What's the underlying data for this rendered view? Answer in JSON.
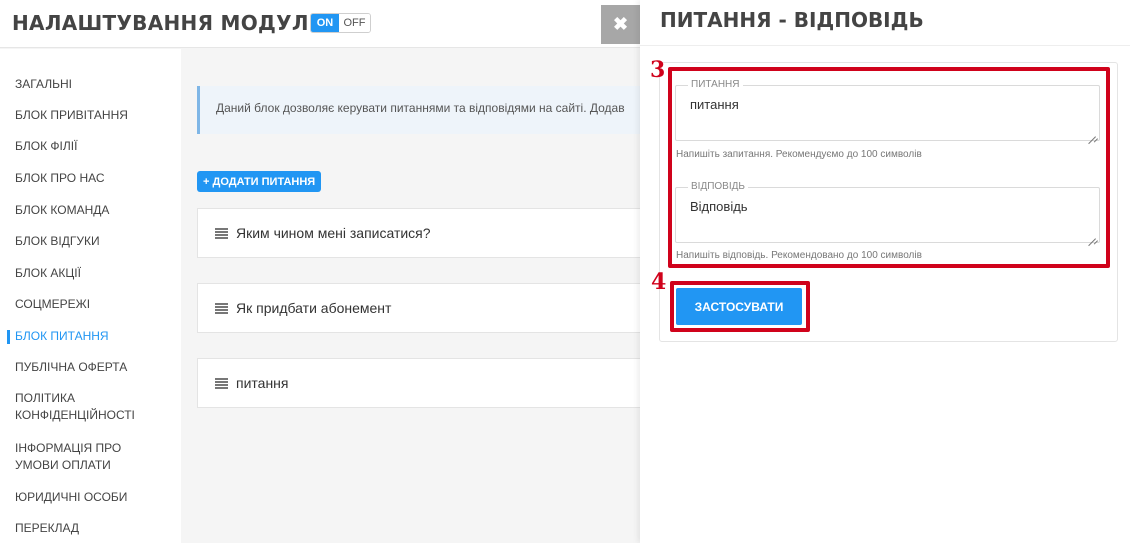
{
  "header": {
    "title": "НАЛАШТУВАННЯ МОДУЛЯ",
    "toggle_on": "ON",
    "toggle_off": "OFF",
    "close_glyph": "✖"
  },
  "sidebar": {
    "active_index": 8,
    "items": [
      {
        "label": "ЗАГАЛЬНІ"
      },
      {
        "label": "БЛОК ПРИВІТАННЯ"
      },
      {
        "label": "БЛОК ФІЛІЇ"
      },
      {
        "label": "БЛОК ПРО НАС"
      },
      {
        "label": "БЛОК КОМАНДА"
      },
      {
        "label": "БЛОК ВІДГУКИ"
      },
      {
        "label": "БЛОК АКЦІЇ"
      },
      {
        "label": "СОЦМЕРЕЖІ"
      },
      {
        "label": "БЛОК ПИТАННЯ"
      },
      {
        "label": "ПУБЛІЧНА ОФЕРТА"
      },
      {
        "label": "ПОЛІТИКА КОНФІДЕНЦІЙНОСТІ"
      },
      {
        "label": "ІНФОРМАЦІЯ ПРО УМОВИ ОПЛАТИ"
      },
      {
        "label": "ЮРИДИЧНІ ОСОБИ"
      },
      {
        "label": "ПЕРЕКЛАД"
      }
    ]
  },
  "main": {
    "info_text": "Даний блок дозволяє керувати питаннями та відповідями на сайті. Додав",
    "add_button": "+ ДОДАТИ ПИТАННЯ",
    "questions": [
      {
        "text": "Яким чином мені записатися?"
      },
      {
        "text": "Як придбати абонемент"
      },
      {
        "text": "питання"
      }
    ]
  },
  "panel": {
    "title": "ПИТАННЯ - ВІДПОВІДЬ",
    "question_field": {
      "label": "ПИТАННЯ",
      "value": "питання",
      "hint": "Напишіть запитання. Рекомендуємо до 100 символів"
    },
    "answer_field": {
      "label": "ВІДПОВІДЬ",
      "value": "Відповідь",
      "hint": "Напишіть відповідь. Рекомендовано до 100 символів"
    },
    "apply_button": "ЗАСТОСУВАТИ"
  },
  "annotations": {
    "step_fields": "3",
    "step_apply": "4"
  },
  "colors": {
    "accent": "#2196f3",
    "annotation": "#d0021b"
  }
}
